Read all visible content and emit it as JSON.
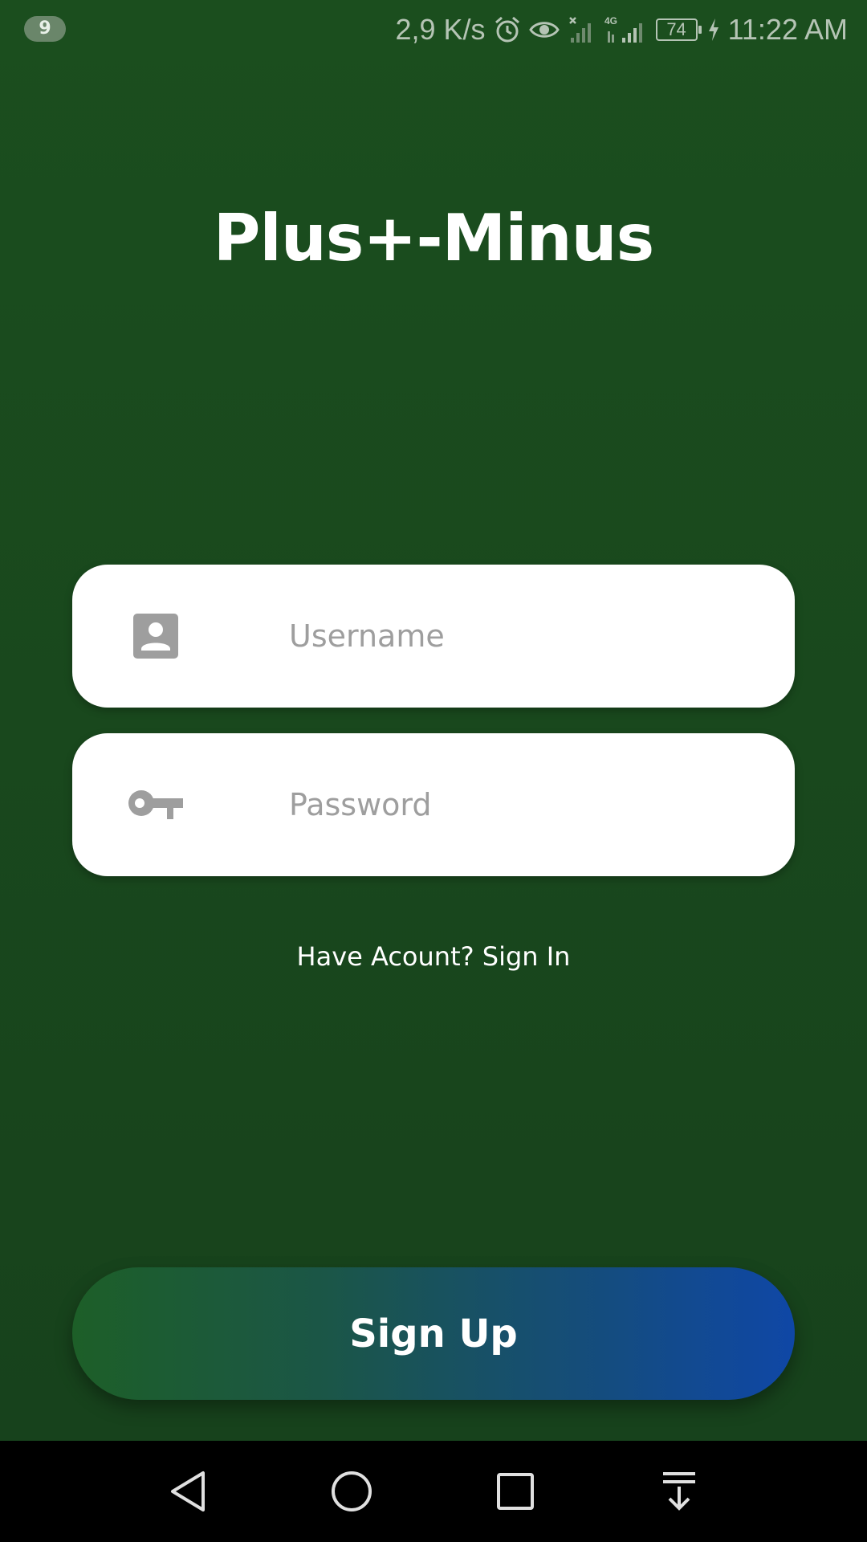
{
  "status_bar": {
    "notification_count": "9",
    "net_speed": "2,9 K/s",
    "battery_level": "74",
    "time": "11:22 AM",
    "icons": [
      "alarm-icon",
      "eye-icon",
      "signal-no-sim-icon",
      "signal-4g-icon",
      "battery-icon",
      "charging-icon"
    ]
  },
  "app": {
    "title": "Plus+-Minus"
  },
  "form": {
    "username_placeholder": "Username",
    "password_placeholder": "Password",
    "username_icon": "account-box-icon",
    "password_icon": "key-icon"
  },
  "links": {
    "sign_in": "Have Acount? Sign In"
  },
  "buttons": {
    "sign_up": "Sign Up"
  },
  "nav_bar": {
    "icons": [
      "back-icon",
      "home-icon",
      "recents-icon",
      "notification-pulldown-icon"
    ]
  },
  "colors": {
    "background": "#19481d",
    "button_start": "#1d5f28",
    "button_end": "#0f47a6",
    "field_background": "#ffffff",
    "placeholder": "#9e9e9e"
  }
}
